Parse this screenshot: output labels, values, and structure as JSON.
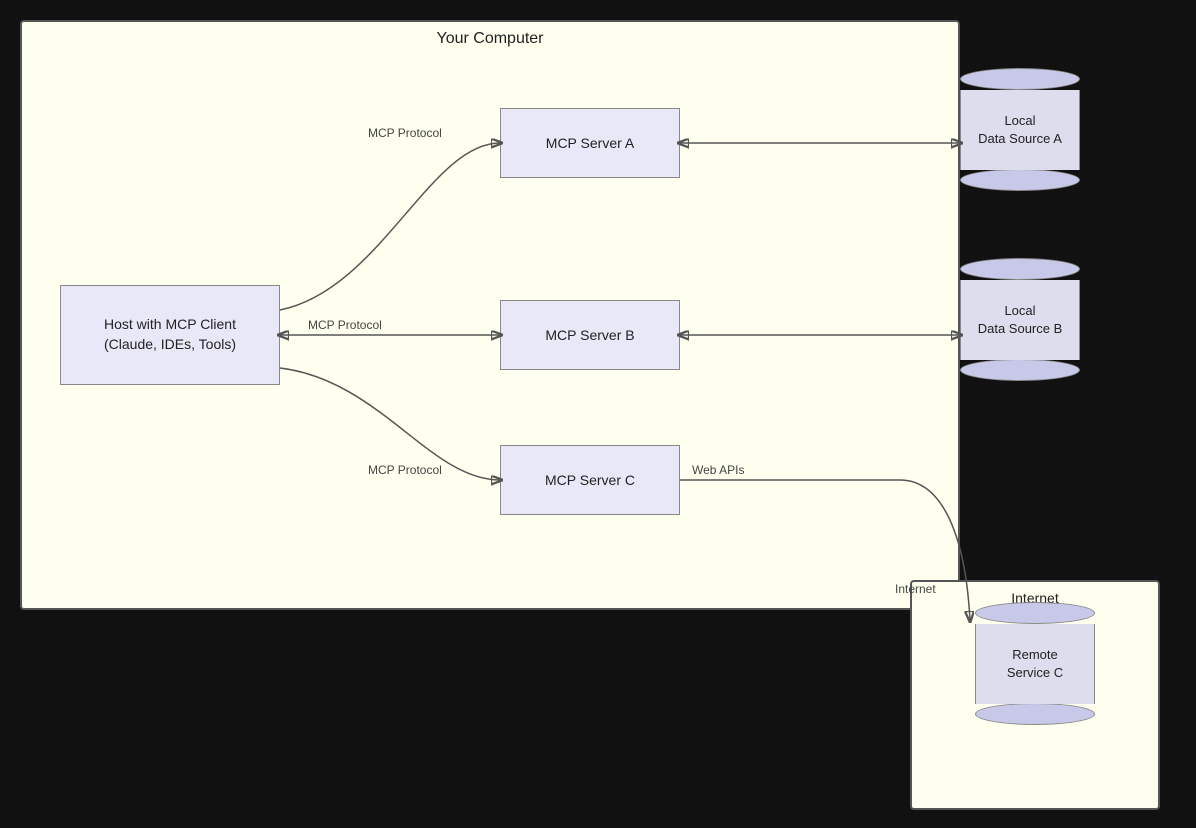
{
  "diagram": {
    "title": "Your Computer",
    "client": {
      "label": "Host with MCP Client\n(Claude, IDEs, Tools)"
    },
    "servers": [
      {
        "id": "server-a",
        "label": "MCP Server A"
      },
      {
        "id": "server-b",
        "label": "MCP Server B"
      },
      {
        "id": "server-c",
        "label": "MCP Server C"
      }
    ],
    "dataSources": [
      {
        "id": "data-source-a",
        "label": "Local\nData Source A"
      },
      {
        "id": "data-source-b",
        "label": "Local\nData Source B"
      }
    ],
    "remoteService": {
      "label": "Remote\nService C"
    },
    "internetLabel": "Internet",
    "arrows": [
      {
        "id": "client-to-server-a",
        "label": "MCP Protocol",
        "direction": "right"
      },
      {
        "id": "client-to-server-b",
        "label": "MCP Protocol",
        "direction": "both"
      },
      {
        "id": "client-to-server-c",
        "label": "MCP Protocol",
        "direction": "right"
      },
      {
        "id": "server-a-to-ds-a",
        "label": "",
        "direction": "both"
      },
      {
        "id": "server-b-to-ds-b",
        "label": "",
        "direction": "both"
      },
      {
        "id": "server-c-to-remote",
        "label": "Web APIs",
        "direction": "left"
      }
    ]
  }
}
